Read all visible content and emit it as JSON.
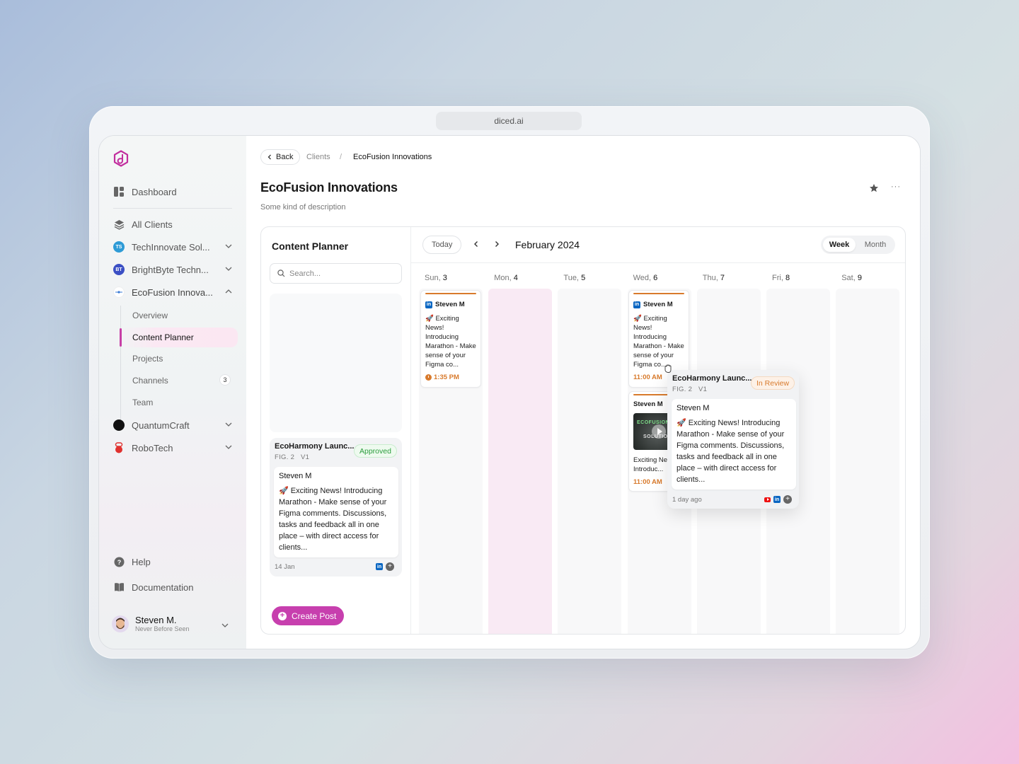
{
  "browser": {
    "url": "diced.ai"
  },
  "sidebar": {
    "logo": "diced-logo-icon",
    "dashboard": "Dashboard",
    "all_clients": "All Clients",
    "clients": [
      {
        "initials": "TS",
        "name": "TechInnovate Sol...",
        "color": "#2e9bd6",
        "expanded": false
      },
      {
        "initials": "BT",
        "name": "BrightByte Techn...",
        "color": "#3b4fc4",
        "expanded": false
      },
      {
        "initials": "",
        "name": "EcoFusion Innova...",
        "color": "#ffffff",
        "expanded": true
      },
      {
        "initials": "",
        "name": "QuantumCraft",
        "color": "#111111",
        "expanded": false
      },
      {
        "initials": "",
        "name": "RoboTech",
        "color": "#e0312f",
        "expanded": false
      }
    ],
    "subnav": [
      {
        "label": "Overview"
      },
      {
        "label": "Content Planner",
        "active": true
      },
      {
        "label": "Projects"
      },
      {
        "label": "Channels",
        "count": "3"
      },
      {
        "label": "Team"
      }
    ],
    "help": "Help",
    "documentation": "Documentation",
    "user": {
      "name": "Steven M.",
      "subtitle": "Never Before Seen"
    }
  },
  "header": {
    "back": "Back",
    "breadcrumb": [
      "Clients",
      "/",
      "EcoFusion Innovations"
    ],
    "title": "EcoFusion Innovations",
    "description": "Some kind of description",
    "more": "···"
  },
  "planner": {
    "title": "Content Planner",
    "search_placeholder": "Search...",
    "backlog_card": {
      "title": "EcoHarmony Launc...",
      "fig": "FIG. 2",
      "version": "V1",
      "status": "Approved",
      "author": "Steven M",
      "text": "🚀 Exciting News! Introducing Marathon - Make sense of your Figma comments. Discussions, tasks and feedback all in one place – with direct access for clients...",
      "date": "14 Jan",
      "channels": [
        "linkedin"
      ]
    },
    "create_post": "Create Post"
  },
  "calendar": {
    "today": "Today",
    "month": "February 2024",
    "views": {
      "week": "Week",
      "month": "Month",
      "active": "Week"
    },
    "days": [
      {
        "dow": "Sun,",
        "num": "3"
      },
      {
        "dow": "Mon,",
        "num": "4",
        "highlight": true
      },
      {
        "dow": "Tue,",
        "num": "5"
      },
      {
        "dow": "Wed,",
        "num": "6"
      },
      {
        "dow": "Thu,",
        "num": "7"
      },
      {
        "dow": "Fri,",
        "num": "8"
      },
      {
        "dow": "Sat,",
        "num": "9"
      }
    ],
    "events": [
      {
        "day": "Sun",
        "author": "Steven M",
        "channel": "linkedin",
        "text": "🚀 Exciting News! Introducing Marathon - Make sense of your Figma co...",
        "time": "1:35 PM"
      },
      {
        "day": "Wed",
        "author": "Steven M",
        "channel": "linkedin",
        "text": "🚀 Exciting News! Introducing Marathon - Make sense of your Figma co...",
        "time": "11:00 AM"
      },
      {
        "day": "Wed",
        "author": "Steven M",
        "channel": "video",
        "thumb_text": [
          "ECOFUSION",
          "SOLUTION"
        ],
        "text": "Exciting News! Introduc...",
        "time": "11:00 AM"
      }
    ],
    "dragging_card": {
      "title": "EcoHarmony Launc...",
      "fig": "FIG. 2",
      "version": "V1",
      "status": "In Review",
      "author": "Steven M",
      "text": "🚀 Exciting News! Introducing Marathon - Make sense of your Figma comments. Discussions, tasks and feedback all in one place – with direct access for clients...",
      "date": "1 day ago",
      "channels": [
        "youtube",
        "linkedin"
      ]
    }
  },
  "colors": {
    "accent": "#c73fae",
    "approved": "#2a9d3c",
    "in_review": "#d87a2c",
    "linkedin": "#0a66c2"
  }
}
